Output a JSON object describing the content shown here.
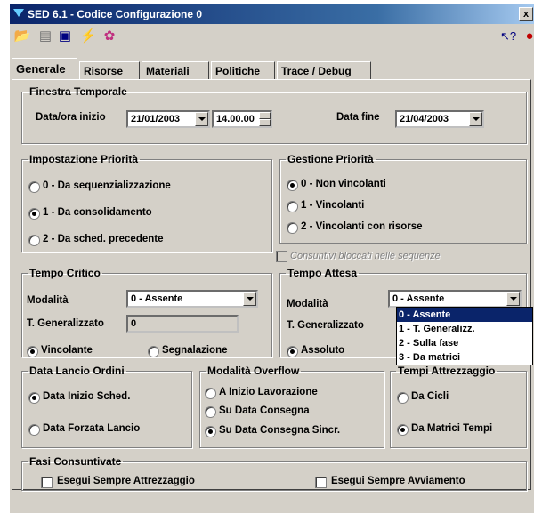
{
  "window": {
    "title": "SED 6.1 - Codice Configurazione 0",
    "close_label": "x"
  },
  "toolbar": {
    "icons": [
      "open-folder-icon",
      "print-icon",
      "save-icon",
      "run-icon",
      "color-icon",
      "help-pointer-icon",
      "exit-icon"
    ]
  },
  "tabs": [
    "Generale",
    "Risorse",
    "Materiali",
    "Politiche",
    "Trace / Debug"
  ],
  "finestra": {
    "legend": "Finestra Temporale",
    "start_label": "Data/ora inizio",
    "start_date": "21/01/2003",
    "start_time": "14.00.00",
    "end_label": "Data fine",
    "end_date": "21/04/2003"
  },
  "impostazione": {
    "legend": "Impostazione Priorità",
    "options": [
      "0 - Da sequenzializzazione",
      "1 - Da consolidamento",
      "2 - Da sched. precedente"
    ],
    "selected": 1
  },
  "gestione": {
    "legend": "Gestione Priorità",
    "options": [
      "0 - Non vincolanti",
      "1 - Vincolanti",
      "2 - Vincolanti con risorse"
    ],
    "selected": 0,
    "checkbox_label": "Consuntivi bloccati nelle sequenze"
  },
  "tempo_critico": {
    "legend": "Tempo Critico",
    "mode_label": "Modalità",
    "mode_value": "0 - Assente",
    "gen_label": "T. Generalizzato",
    "gen_value": "0",
    "radio1": "Vincolante",
    "radio2": "Segnalazione"
  },
  "tempo_attesa": {
    "legend": "Tempo Attesa",
    "mode_label": "Modalità",
    "mode_value": "0 - Assente",
    "gen_label": "T. Generalizzato",
    "radio1": "Assoluto",
    "dropdown_options": [
      "0 - Assente",
      "1 - T. Generalizz.",
      "2 - Sulla fase",
      "3 - Da matrici"
    ],
    "dropdown_selected": 0
  },
  "data_lancio": {
    "legend": "Data Lancio Ordini",
    "options": [
      "Data Inizio Sched.",
      "Data Forzata Lancio"
    ],
    "selected": 0
  },
  "overflow": {
    "legend": "Modalità Overflow",
    "options": [
      "A Inizio Lavorazione",
      "Su Data Consegna",
      "Su Data Consegna Sincr."
    ],
    "selected": 2
  },
  "attrezzaggio": {
    "legend": "Tempi Attrezzaggio",
    "options": [
      "Da Cicli",
      "Da Matrici Tempi"
    ],
    "selected": 1
  },
  "fasi": {
    "legend": "Fasi Consuntivate",
    "check1": "Esegui Sempre Attrezzaggio",
    "check2": "Esegui Sempre Avviamento"
  }
}
